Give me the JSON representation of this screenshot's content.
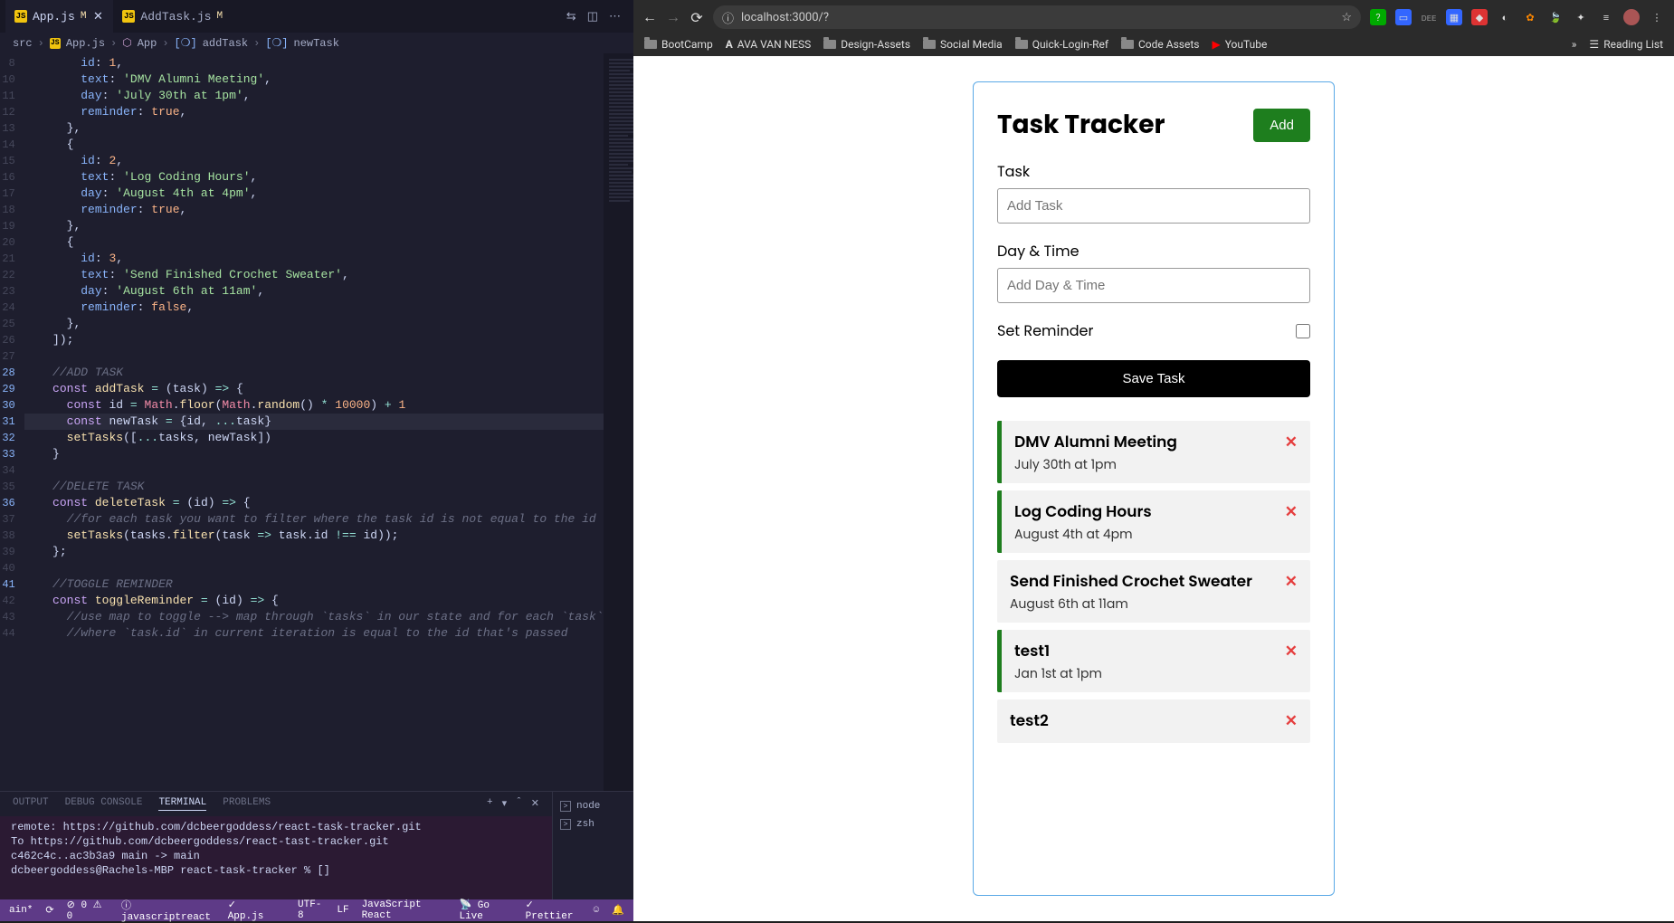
{
  "vscode": {
    "tabs": [
      {
        "name": "App.js",
        "modified": "M",
        "active": true
      },
      {
        "name": "AddTask.js",
        "modified": "M",
        "active": false
      }
    ],
    "breadcrumbs": {
      "folder": "src",
      "file": "App.js",
      "sym1": "App",
      "sym2": "addTask",
      "sym3": "newTask"
    },
    "lines": [
      {
        "n": 8,
        "html": "        <span class='tok-prop'>id</span><span class='tok-punc'>:</span> <span class='tok-num'>1</span><span class='tok-punc'>,</span>"
      },
      {
        "n": 10,
        "html": "        <span class='tok-prop'>text</span><span class='tok-punc'>:</span> <span class='tok-str'>'DMV Alumni Meeting'</span><span class='tok-punc'>,</span>"
      },
      {
        "n": 11,
        "html": "        <span class='tok-prop'>day</span><span class='tok-punc'>:</span> <span class='tok-str'>'July 30th at 1pm'</span><span class='tok-punc'>,</span>"
      },
      {
        "n": 12,
        "html": "        <span class='tok-prop'>reminder</span><span class='tok-punc'>:</span> <span class='tok-bool'>true</span><span class='tok-punc'>,</span>"
      },
      {
        "n": 13,
        "html": "      <span class='tok-punc'>},</span>"
      },
      {
        "n": 14,
        "html": "      <span class='tok-punc'>{</span>"
      },
      {
        "n": 15,
        "html": "        <span class='tok-prop'>id</span><span class='tok-punc'>:</span> <span class='tok-num'>2</span><span class='tok-punc'>,</span>"
      },
      {
        "n": 16,
        "html": "        <span class='tok-prop'>text</span><span class='tok-punc'>:</span> <span class='tok-str'>'Log Coding Hours'</span><span class='tok-punc'>,</span>"
      },
      {
        "n": 17,
        "html": "        <span class='tok-prop'>day</span><span class='tok-punc'>:</span> <span class='tok-str'>'August 4th at 4pm'</span><span class='tok-punc'>,</span>"
      },
      {
        "n": 18,
        "html": "        <span class='tok-prop'>reminder</span><span class='tok-punc'>:</span> <span class='tok-bool'>true</span><span class='tok-punc'>,</span>"
      },
      {
        "n": 19,
        "html": "      <span class='tok-punc'>},</span>"
      },
      {
        "n": 20,
        "html": "      <span class='tok-punc'>{</span>"
      },
      {
        "n": 21,
        "html": "        <span class='tok-prop'>id</span><span class='tok-punc'>:</span> <span class='tok-num'>3</span><span class='tok-punc'>,</span>"
      },
      {
        "n": 22,
        "html": "        <span class='tok-prop'>text</span><span class='tok-punc'>:</span> <span class='tok-str'>'Send Finished Crochet Sweater'</span><span class='tok-punc'>,</span>"
      },
      {
        "n": 23,
        "html": "        <span class='tok-prop'>day</span><span class='tok-punc'>:</span> <span class='tok-str'>'August 6th at 11am'</span><span class='tok-punc'>,</span>"
      },
      {
        "n": 24,
        "html": "        <span class='tok-prop'>reminder</span><span class='tok-punc'>:</span> <span class='tok-bool'>false</span><span class='tok-punc'>,</span>"
      },
      {
        "n": 25,
        "html": "      <span class='tok-punc'>},</span>"
      },
      {
        "n": 26,
        "html": "    <span class='tok-punc'>]);</span>"
      },
      {
        "n": 27,
        "html": ""
      },
      {
        "n": 28,
        "html": "    <span class='tok-cmt'>//ADD TASK</span>",
        "mod": true
      },
      {
        "n": 29,
        "html": "    <span class='tok-kw'>const</span> <span class='tok-fn'>addTask</span> <span class='tok-op'>=</span> <span class='tok-punc'>(</span><span class='tok-var'>task</span><span class='tok-punc'>)</span> <span class='tok-op'>=></span> <span class='tok-punc'>{</span>",
        "mod": true
      },
      {
        "n": 30,
        "html": "      <span class='tok-kw'>const</span> <span class='tok-var'>id</span> <span class='tok-op'>=</span> <span class='tok-const'>Math</span><span class='tok-punc'>.</span><span class='tok-fn'>floor</span><span class='tok-punc'>(</span><span class='tok-const'>Math</span><span class='tok-punc'>.</span><span class='tok-fn'>random</span><span class='tok-punc'>()</span> <span class='tok-op'>*</span> <span class='tok-num'>10000</span><span class='tok-punc'>)</span> <span class='tok-op'>+</span> <span class='tok-num'>1</span>",
        "mod": true
      },
      {
        "n": 31,
        "html": "      <span class='tok-kw'>const</span> <span class='tok-var'>newTask</span> <span class='tok-op'>=</span> <span class='tok-punc'>{</span><span class='tok-var'>id</span><span class='tok-punc'>,</span> <span class='tok-op'>...</span><span class='tok-var'>task</span><span class='tok-punc'>}</span>",
        "mod": true,
        "hl": true
      },
      {
        "n": 32,
        "html": "      <span class='tok-fn'>setTasks</span><span class='tok-punc'>([</span><span class='tok-op'>...</span><span class='tok-var'>tasks</span><span class='tok-punc'>,</span> <span class='tok-var'>newTask</span><span class='tok-punc'>])</span>",
        "mod": true
      },
      {
        "n": 33,
        "html": "    <span class='tok-punc'>}</span>",
        "mod": true
      },
      {
        "n": 34,
        "html": ""
      },
      {
        "n": 35,
        "html": "    <span class='tok-cmt'>//DELETE TASK</span>"
      },
      {
        "n": 36,
        "html": "    <span class='tok-kw'>const</span> <span class='tok-fn'>deleteTask</span> <span class='tok-op'>=</span> <span class='tok-punc'>(</span><span class='tok-var'>id</span><span class='tok-punc'>)</span> <span class='tok-op'>=></span> <span class='tok-punc'>{</span>",
        "mod": true
      },
      {
        "n": 37,
        "html": "      <span class='tok-cmt'>//for each task you want to filter where the task id is not equal to the id</span>"
      },
      {
        "n": 38,
        "html": "      <span class='tok-fn'>setTasks</span><span class='tok-punc'>(</span><span class='tok-var'>tasks</span><span class='tok-punc'>.</span><span class='tok-fn'>filter</span><span class='tok-punc'>(</span><span class='tok-var'>task</span> <span class='tok-op'>=></span> <span class='tok-var'>task</span><span class='tok-punc'>.</span><span class='tok-var'>id</span> <span class='tok-op'>!==</span> <span class='tok-var'>id</span><span class='tok-punc'>));</span>"
      },
      {
        "n": 39,
        "html": "    <span class='tok-punc'>};</span>"
      },
      {
        "n": 40,
        "html": ""
      },
      {
        "n": 41,
        "html": "    <span class='tok-cmt'>//TOGGLE REMINDER</span>",
        "mod": true
      },
      {
        "n": 42,
        "html": "    <span class='tok-kw'>const</span> <span class='tok-fn'>toggleReminder</span> <span class='tok-op'>=</span> <span class='tok-punc'>(</span><span class='tok-var'>id</span><span class='tok-punc'>)</span> <span class='tok-op'>=></span> <span class='tok-punc'>{</span>"
      },
      {
        "n": 43,
        "html": "      <span class='tok-cmt'>//use map to toggle --> map through `tasks` in our state and for each `task`</span>"
      },
      {
        "n": 44,
        "html": "      <span class='tok-cmt'>//where `task.id` in current iteration is equal to the id that's passed</span>"
      }
    ],
    "panel": {
      "tabs": [
        "OUTPUT",
        "DEBUG CONSOLE",
        "TERMINAL",
        "PROBLEMS"
      ],
      "active": "TERMINAL",
      "terminal_lines": [
        "remote:   https://github.com/dcbeergoddess/react-task-tracker.git",
        "To https://github.com/dcbeergoddess/react-tast-tracker.git",
        "   c462c4c..ac3b3a9  main -> main",
        "dcbeergoddess@Rachels-MBP react-task-tracker % []"
      ],
      "side": [
        "node",
        "zsh"
      ]
    },
    "statusbar": {
      "branch": "ain*",
      "errors": "0",
      "warnings": "0",
      "lang_mode": "javascriptreact",
      "file": "App.js",
      "encoding": "UTF-8",
      "eol": "LF",
      "lang": "JavaScript React",
      "golive": "Go Live",
      "prettier": "Prettier"
    }
  },
  "browser": {
    "url": "localhost:3000/?",
    "bookmarks": [
      "BootCamp",
      "AVA VAN NESS",
      "Design-Assets",
      "Social Media",
      "Quick-Login-Ref",
      "Code Assets",
      "YouTube"
    ],
    "bookmarks_right": "Reading List",
    "app": {
      "title": "Task Tracker",
      "add_btn": "Add",
      "form": {
        "task_label": "Task",
        "task_placeholder": "Add Task",
        "day_label": "Day & Time",
        "day_placeholder": "Add Day & Time",
        "reminder_label": "Set Reminder",
        "save_btn": "Save Task"
      },
      "tasks": [
        {
          "text": "DMV Alumni Meeting",
          "day": "July 30th at 1pm",
          "reminder": true
        },
        {
          "text": "Log Coding Hours",
          "day": "August 4th at 4pm",
          "reminder": true
        },
        {
          "text": "Send Finished Crochet Sweater",
          "day": "August 6th at 11am",
          "reminder": false
        },
        {
          "text": "test1",
          "day": "Jan 1st at 1pm",
          "reminder": true
        },
        {
          "text": "test2",
          "day": "",
          "reminder": false
        }
      ]
    }
  }
}
